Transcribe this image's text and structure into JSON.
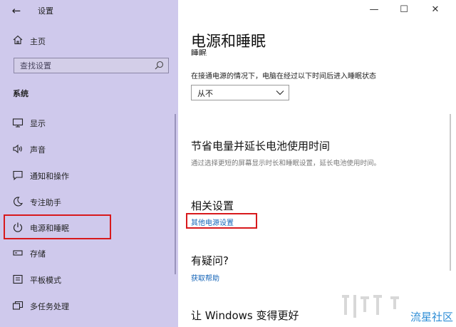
{
  "titlebar": {
    "back_glyph": "←",
    "app_title": "设置",
    "minimize_glyph": "—",
    "maximize_glyph": "☐",
    "close_glyph": "✕"
  },
  "sidebar": {
    "home_label": "主页",
    "search_placeholder": "查找设置",
    "section_title": "系统",
    "items": [
      {
        "label": "显示",
        "icon": "display-icon"
      },
      {
        "label": "声音",
        "icon": "speaker-icon"
      },
      {
        "label": "通知和操作",
        "icon": "notification-icon"
      },
      {
        "label": "专注助手",
        "icon": "moon-icon"
      },
      {
        "label": "电源和睡眠",
        "icon": "power-icon"
      },
      {
        "label": "存储",
        "icon": "storage-icon"
      },
      {
        "label": "平板模式",
        "icon": "tablet-icon"
      },
      {
        "label": "多任务处理",
        "icon": "multitask-icon"
      }
    ]
  },
  "main": {
    "title": "电源和睡眠",
    "cut_heading": "睡眠",
    "sleep_desc": "在接通电源的情况下，电脑在经过以下时间后进入睡眠状态",
    "sleep_value": "从不",
    "save_heading": "节省电量并延长电池使用时间",
    "save_note": "通过选择更短的屏幕显示时长和睡眠设置，延长电池使用时间。",
    "related_heading": "相关设置",
    "related_link": "其他电源设置",
    "question_heading": "有疑问?",
    "help_link": "获取帮助",
    "better_heading": "让 Windows 变得更好"
  },
  "watermark": "流星社区",
  "colors": {
    "sidebar_bg": "#cfc9ec",
    "highlight": "#d8191c",
    "link": "#1665b8"
  }
}
